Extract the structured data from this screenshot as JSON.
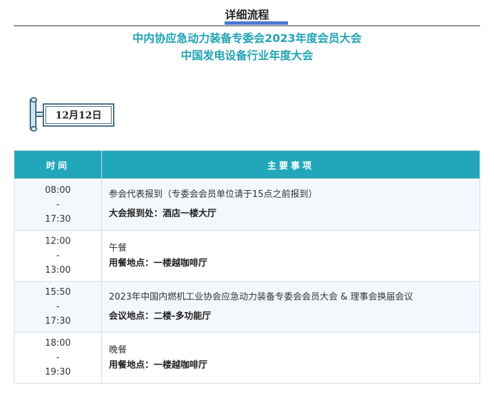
{
  "header": {
    "title": "详细流程",
    "accent_color": "#4a77d4"
  },
  "subtitle": {
    "line1": "中内协应急动力装备专委会2023年度会员大会",
    "line2": "中国发电设备行业年度大会",
    "color": "#1fa3b5"
  },
  "date_sign": {
    "label": "12月12日"
  },
  "table": {
    "header_color": "#22a7ba",
    "headers": {
      "time": "时间",
      "item": "主要事项"
    },
    "rows": [
      {
        "start": "08:00",
        "sep": "-",
        "end": "17:30",
        "desc": "参会代表报到（专委会会员单位请于15点之前报到）",
        "loc": "大会报到处：酒店一楼大厅"
      },
      {
        "start": "12:00",
        "sep": "-",
        "end": "13:00",
        "desc": "午餐",
        "loc": "用餐地点：一楼越咖啡厅"
      },
      {
        "start": "15:50",
        "sep": "-",
        "end": "17:30",
        "desc": "2023年中国内燃机工业协会应急动力装备专委会会员大会 & 理事会换届会议",
        "loc": "会议地点：二楼-多功能厅"
      },
      {
        "start": "18:00",
        "sep": "-",
        "end": "19:30",
        "desc": "晚餐",
        "loc": "用餐地点：一楼越咖啡厅"
      }
    ]
  }
}
